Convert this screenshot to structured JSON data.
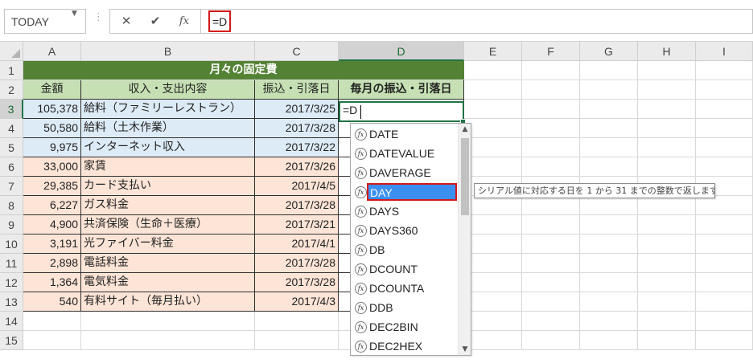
{
  "formula_bar": {
    "name_box": "TODAY",
    "cancel_icon": "✕",
    "enter_icon": "✔",
    "fx_label": "fx",
    "formula": "=D"
  },
  "columns": [
    "A",
    "B",
    "C",
    "D",
    "E",
    "F",
    "G",
    "H",
    "I"
  ],
  "rows": [
    "1",
    "2",
    "3",
    "4",
    "5",
    "6",
    "7",
    "8",
    "9",
    "10",
    "11",
    "12",
    "13",
    "14",
    "15"
  ],
  "sheet": {
    "title": "月々の固定費",
    "headers": [
      "金額",
      "収入・支出内容",
      "振込・引落日",
      "毎月の振込・引落日"
    ],
    "data": [
      {
        "amount": "105,378",
        "item": "給料（ファミリーレストラン）",
        "date": "2017/3/25",
        "type": "income"
      },
      {
        "amount": "50,580",
        "item": "給料（土木作業）",
        "date": "2017/3/28",
        "type": "income"
      },
      {
        "amount": "9,975",
        "item": "インターネット収入",
        "date": "2017/3/22",
        "type": "income"
      },
      {
        "amount": "33,000",
        "item": "家賃",
        "date": "2017/3/26",
        "type": "expense"
      },
      {
        "amount": "29,385",
        "item": "カード支払い",
        "date": "2017/4/5",
        "type": "expense"
      },
      {
        "amount": "6,227",
        "item": "ガス料金",
        "date": "2017/3/28",
        "type": "expense"
      },
      {
        "amount": "4,900",
        "item": "共済保険（生命＋医療）",
        "date": "2017/3/21",
        "type": "expense"
      },
      {
        "amount": "3,191",
        "item": "光ファイバー料金",
        "date": "2017/4/1",
        "type": "expense"
      },
      {
        "amount": "2,898",
        "item": "電話料金",
        "date": "2017/3/28",
        "type": "expense"
      },
      {
        "amount": "1,364",
        "item": "電気料金",
        "date": "2017/3/28",
        "type": "expense"
      },
      {
        "amount": "540",
        "item": "有料サイト（毎月払い）",
        "date": "2017/4/3",
        "type": "expense"
      }
    ],
    "active_cell_text": "=D"
  },
  "autocomplete": {
    "items": [
      "DATE",
      "DATEVALUE",
      "DAVERAGE",
      "DAY",
      "DAYS",
      "DAYS360",
      "DB",
      "DCOUNT",
      "DCOUNTA",
      "DDB",
      "DEC2BIN",
      "DEC2HEX"
    ],
    "selected": "DAY",
    "icon_glyph": "fx",
    "tooltip": "シリアル値に対応する日を 1 から 31 までの整数で返します。"
  },
  "colors": {
    "title_bg": "#548235",
    "header_bg": "#c6e0b4",
    "income_bg": "#ddebf7",
    "expense_bg": "#fce4d6",
    "selection": "#217346",
    "highlight_border": "#d41919",
    "dropdown_selected": "#3b8ff0"
  }
}
